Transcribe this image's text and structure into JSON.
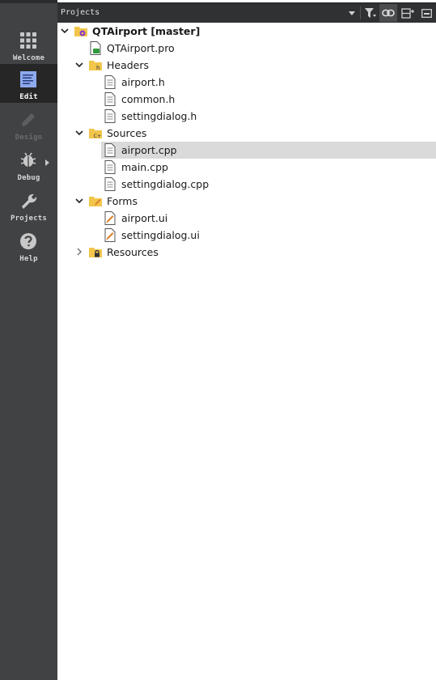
{
  "modebar": {
    "modes": [
      {
        "label": "Welcome",
        "icon": "grid-icon"
      },
      {
        "label": "Edit",
        "icon": "document-icon"
      },
      {
        "label": "Design",
        "icon": "pencil-icon"
      },
      {
        "label": "Debug",
        "icon": "bug-icon"
      },
      {
        "label": "Projects",
        "icon": "wrench-icon"
      },
      {
        "label": "Help",
        "icon": "help-icon"
      }
    ],
    "active": "Edit",
    "disabled": "Design"
  },
  "toolbar": {
    "title": "Projects",
    "buttons": [
      "chevron-down-icon",
      "filter-icon",
      "link-icon",
      "split-icon",
      "close-pane-icon"
    ]
  },
  "tree": {
    "project": "QTAirport [master]",
    "pro_file": "QTAirport.pro",
    "headers": {
      "label": "Headers",
      "files": [
        "airport.h",
        "common.h",
        "settingdialog.h"
      ]
    },
    "sources": {
      "label": "Sources",
      "files": [
        "airport.cpp",
        "main.cpp",
        "settingdialog.cpp"
      ]
    },
    "forms": {
      "label": "Forms",
      "files": [
        "airport.ui",
        "settingdialog.ui"
      ]
    },
    "resources": {
      "label": "Resources"
    },
    "selected": "airport.cpp"
  },
  "colors": {
    "modebar_bg": "#404244",
    "toolbar_bg": "#2f3133",
    "selection": "#dadada",
    "folder": "#f2c54b",
    "ui_pencil": "#d9822b"
  }
}
